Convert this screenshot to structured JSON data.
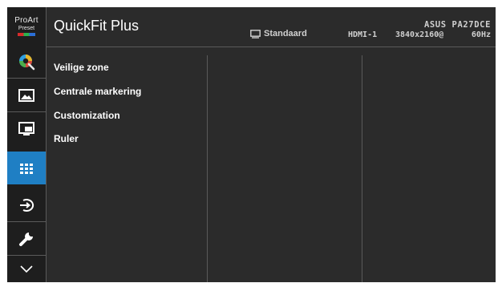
{
  "brand": {
    "line1": "ProArt",
    "line2": "Preset"
  },
  "header": {
    "title": "QuickFit Plus",
    "mode_label": "Standaard",
    "model": "ASUS PA27DCE",
    "input": "HDMI-1",
    "resolution": "3840x2160@",
    "refresh": "60Hz"
  },
  "sidebar": {
    "items": [
      {
        "icon": "color-palette-icon"
      },
      {
        "icon": "image-icon"
      },
      {
        "icon": "pip-icon"
      },
      {
        "icon": "quickfit-grid-icon",
        "active": true
      },
      {
        "icon": "input-select-icon"
      },
      {
        "icon": "wrench-icon"
      },
      {
        "icon": "chevron-down-icon"
      }
    ]
  },
  "menu": {
    "items": [
      {
        "label": "Veilige zone"
      },
      {
        "label": "Centrale markering"
      },
      {
        "label": "Customization"
      },
      {
        "label": "Ruler"
      }
    ]
  },
  "colors": {
    "panel": "#2b2b2b",
    "sidebar": "#1e1e1e",
    "active": "#1f7fc4",
    "divider": "#5a5a5a"
  }
}
